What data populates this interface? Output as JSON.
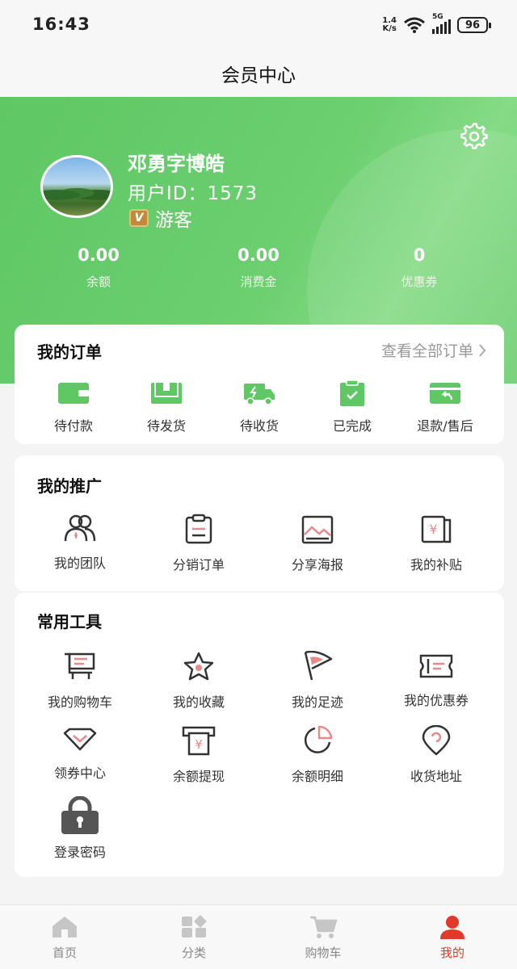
{
  "status_bar": {
    "time": "16:43",
    "net_speed_value": "1.4",
    "net_speed_unit": "K/s",
    "network": "5G",
    "battery": "96",
    "icons": [
      "wifi-icon",
      "signal-icon",
      "battery-icon"
    ]
  },
  "page": {
    "title": "会员中心"
  },
  "profile": {
    "name": "邓勇字博皓",
    "user_id_label": "用户ID：",
    "user_id": "1573",
    "role": "游客",
    "role_badge": "V"
  },
  "stats": [
    {
      "value": "0.00",
      "label": "余额"
    },
    {
      "value": "0.00",
      "label": "消费金"
    },
    {
      "value": "0",
      "label": "优惠券"
    }
  ],
  "orders": {
    "title": "我的订单",
    "view_all": "查看全部订单",
    "items": [
      {
        "label": "待付款",
        "icon": "wallet-icon"
      },
      {
        "label": "待发货",
        "icon": "box-icon"
      },
      {
        "label": "待收货",
        "icon": "truck-icon"
      },
      {
        "label": "已完成",
        "icon": "clipboard-check-icon"
      },
      {
        "label": "退款/售后",
        "icon": "refund-icon"
      }
    ]
  },
  "promotion": {
    "title": "我的推广",
    "items": [
      {
        "label": "我的团队",
        "icon": "team-icon"
      },
      {
        "label": "分销订单",
        "icon": "clipboard-icon"
      },
      {
        "label": "分享海报",
        "icon": "poster-icon"
      },
      {
        "label": "我的补贴",
        "icon": "subsidy-icon"
      }
    ]
  },
  "tools": {
    "title": "常用工具",
    "items": [
      {
        "label": "我的购物车",
        "icon": "cart-icon"
      },
      {
        "label": "我的收藏",
        "icon": "star-icon"
      },
      {
        "label": "我的足迹",
        "icon": "flag-icon"
      },
      {
        "label": "我的优惠券",
        "icon": "coupon-icon"
      },
      {
        "label": "领券中心",
        "icon": "diamond-icon"
      },
      {
        "label": "余额提现",
        "icon": "withdraw-icon"
      },
      {
        "label": "余额明细",
        "icon": "pie-icon"
      },
      {
        "label": "收货地址",
        "icon": "location-icon"
      },
      {
        "label": "登录密码",
        "icon": "lock-icon"
      }
    ]
  },
  "bottom_nav": {
    "items": [
      {
        "label": "首页",
        "icon": "home-icon"
      },
      {
        "label": "分类",
        "icon": "category-icon"
      },
      {
        "label": "购物车",
        "icon": "cart-icon"
      },
      {
        "label": "我的",
        "icon": "user-icon"
      }
    ],
    "active_index": 3
  },
  "colors": {
    "brand_green": "#6ccf70",
    "active_red": "#e23a2a",
    "icon_accent": "#e98a8a"
  }
}
